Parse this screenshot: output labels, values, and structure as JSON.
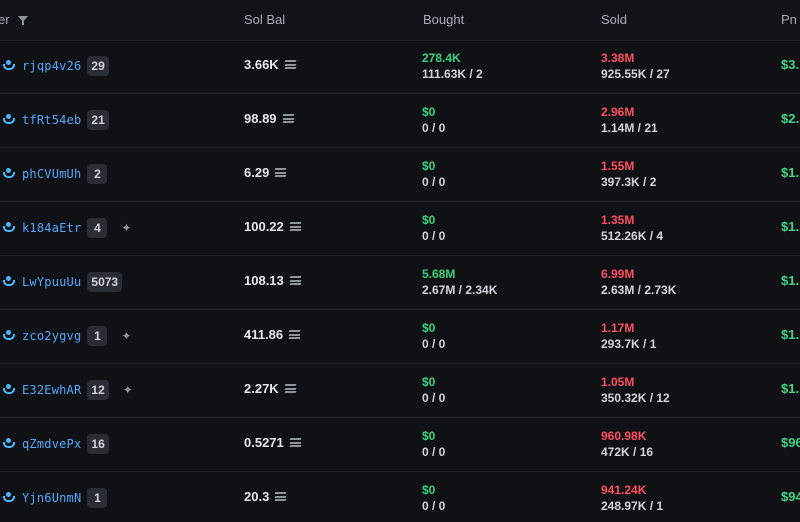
{
  "header": {
    "trader_label": "er",
    "sol_bal_label": "Sol Bal",
    "bought_label": "Bought",
    "sold_label": "Sold",
    "pnl_label": "Pn"
  },
  "rows": [
    {
      "trader": "rjqp4v26",
      "count": "29",
      "sol_bal": "3.66K",
      "bought_top": "278.4K",
      "bought_bottom": "111.63K / 2",
      "sold_top": "3.38M",
      "sold_bottom": "925.55K / 27",
      "pnl": "$3."
    },
    {
      "trader": "tfRt54eb",
      "count": "21",
      "sol_bal": "98.89",
      "bought_top": "$0",
      "bought_bottom": "0 / 0",
      "sold_top": "2.96M",
      "sold_bottom": "1.14M / 21",
      "pnl": "$2."
    },
    {
      "trader": "phCVUmUh",
      "count": "2",
      "sol_bal": "6.29",
      "bought_top": "$0",
      "bought_bottom": "0 / 0",
      "sold_top": "1.55M",
      "sold_bottom": "397.3K / 2",
      "pnl": "$1."
    },
    {
      "trader": "k184aEtr",
      "count": "4",
      "sol_bal": "100.22",
      "bought_top": "$0",
      "bought_bottom": "0 / 0",
      "sold_top": "1.35M",
      "sold_bottom": "512.26K / 4",
      "pnl": "$1."
    },
    {
      "trader": "LwYpuuUu",
      "count": "5073",
      "sol_bal": "108.13",
      "bought_top": "5.68M",
      "bought_bottom": "2.67M / 2.34K",
      "sold_top": "6.99M",
      "sold_bottom": "2.63M / 2.73K",
      "pnl": "$1."
    },
    {
      "trader": "zco2ygvg",
      "count": "1",
      "sol_bal": "411.86",
      "bought_top": "$0",
      "bought_bottom": "0 / 0",
      "sold_top": "1.17M",
      "sold_bottom": "293.7K / 1",
      "pnl": "$1."
    },
    {
      "trader": "E32EwhAR",
      "count": "12",
      "sol_bal": "2.27K",
      "bought_top": "$0",
      "bought_bottom": "0 / 0",
      "sold_top": "1.05M",
      "sold_bottom": "350.32K / 12",
      "pnl": "$1."
    },
    {
      "trader": "qZmdvePx",
      "count": "16",
      "sol_bal": "0.5271",
      "bought_top": "$0",
      "bought_bottom": "0 / 0",
      "sold_top": "960.98K",
      "sold_bottom": "472K / 16",
      "pnl": "$96"
    },
    {
      "trader": "Yjn6UnmN",
      "count": "1",
      "sol_bal": "20.3",
      "bought_top": "$0",
      "bought_bottom": "0 / 0",
      "sold_top": "941.24K",
      "sold_bottom": "248.97K / 1",
      "pnl": "$94"
    }
  ],
  "icons": {
    "top_indicator": "active-tab-indicator",
    "filter": "filter-icon",
    "trader": "user-icon",
    "sol": "solana-icon",
    "sparkle": "sparkle-icon"
  },
  "colors": {
    "positive": "#35d37f",
    "negative": "#ff4f62",
    "trader": "#53a7ff",
    "background": "#101114"
  }
}
